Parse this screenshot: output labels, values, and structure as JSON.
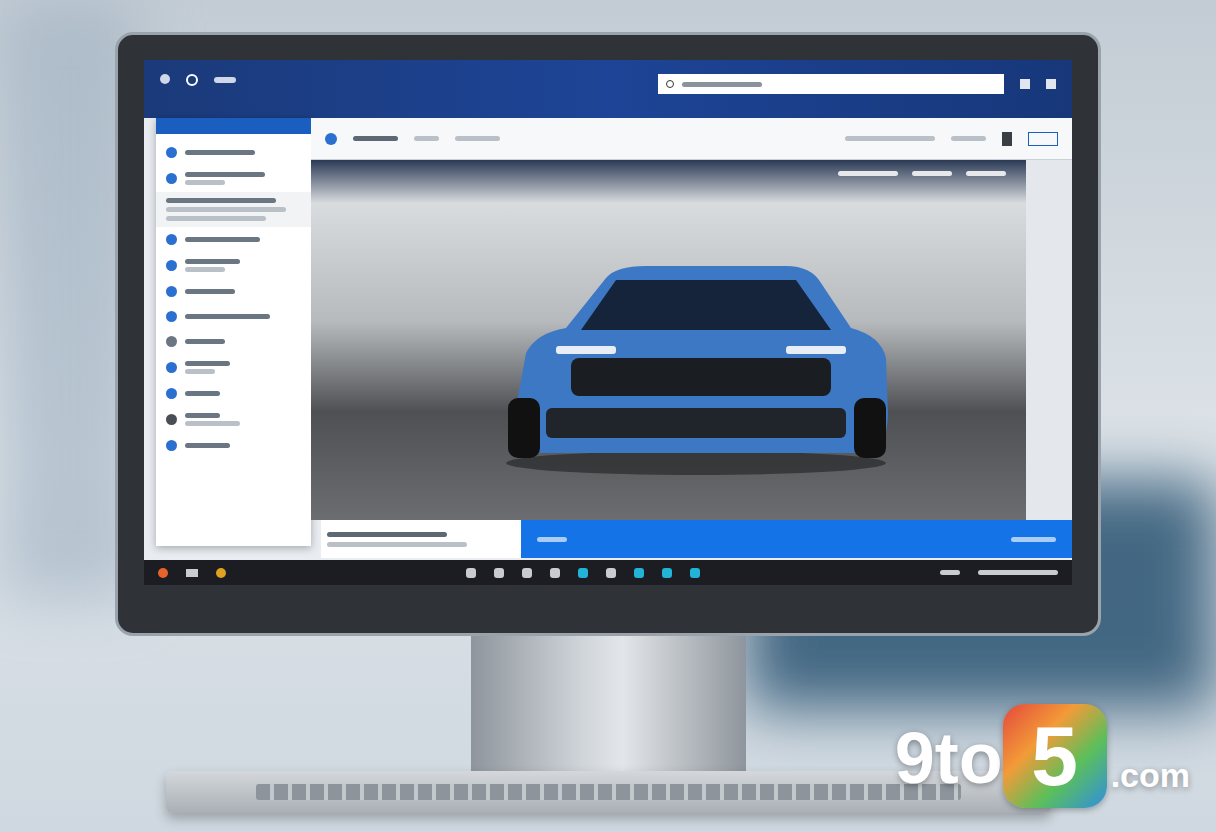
{
  "watermark": {
    "text": "9to",
    "badge": "5",
    "suffix": ".com"
  }
}
